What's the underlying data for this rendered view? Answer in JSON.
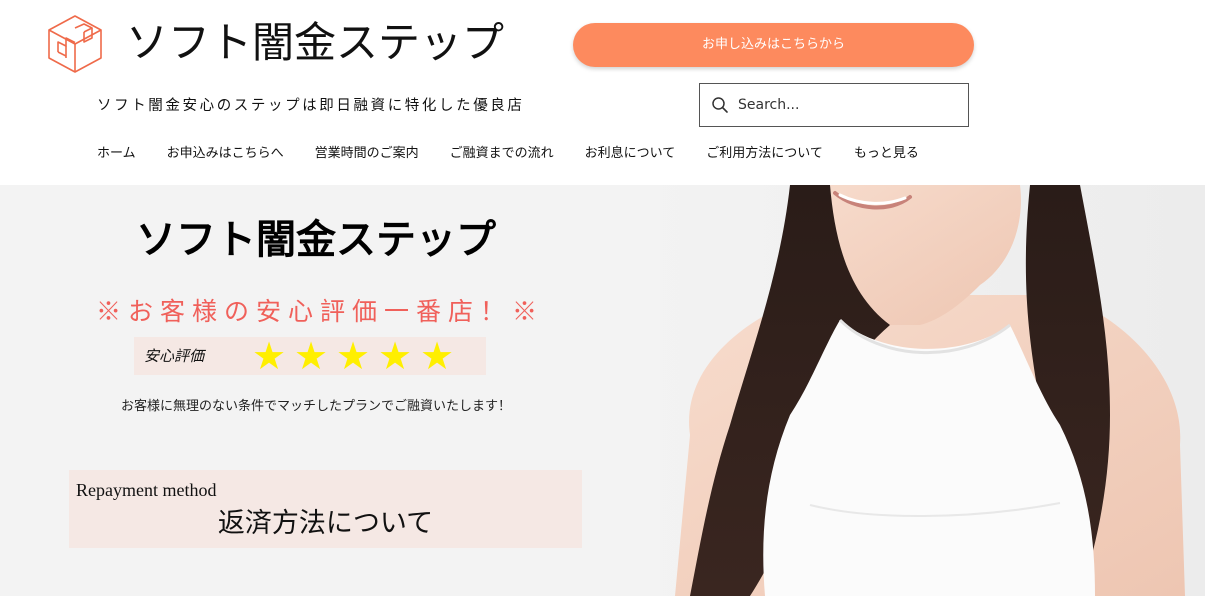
{
  "header": {
    "logo_icon": "cube-stairs-logo",
    "site_title": "ソフト闇金ステップ",
    "cta_label": "お申し込みはこちらから",
    "tagline": "ソフト闇金安心のステップは即日融資に特化した優良店",
    "search": {
      "placeholder": "Search...",
      "value": ""
    },
    "accent_color": "#fd8a5e"
  },
  "nav": {
    "items": [
      {
        "label": "ホーム"
      },
      {
        "label": "お申込みはこちらへ"
      },
      {
        "label": "営業時間のご案内"
      },
      {
        "label": "ご融資までの流れ"
      },
      {
        "label": "お利息について"
      },
      {
        "label": "ご利用方法について"
      },
      {
        "label": "もっと見る"
      }
    ]
  },
  "hero": {
    "heading": "ソフト闇金ステップ",
    "banner": "※お客様の安心評価一番店！※",
    "banner_color": "#f0605a",
    "rating": {
      "label": "安心評価",
      "stars": 5,
      "max": 5,
      "star_color": "#ffef00"
    },
    "subtext": "お客様に無理のない条件でマッチしたプランでご融資いたします！",
    "repayment": {
      "en": "Repayment method",
      "ja": "返済方法について"
    },
    "photo": "smiling-woman-photo"
  }
}
